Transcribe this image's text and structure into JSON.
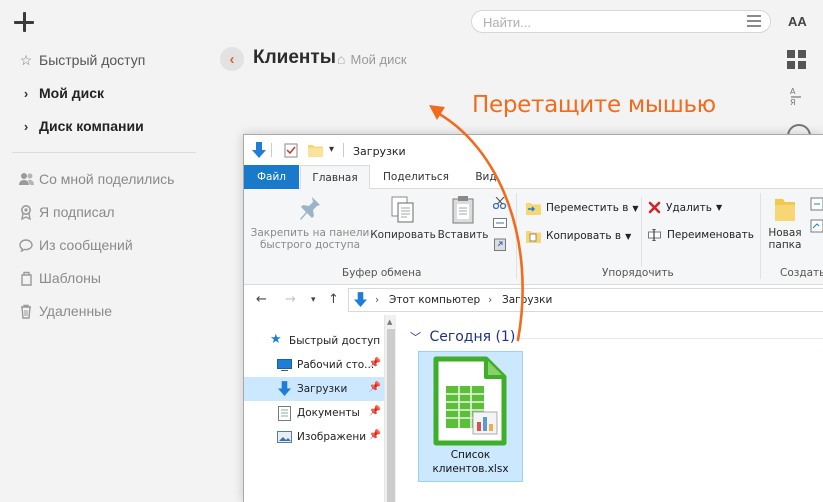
{
  "app": {
    "search_placeholder": "Найти...",
    "font_toggle_label": "AA",
    "sidebar": {
      "items": [
        {
          "label": "Быстрый доступ",
          "icon": "star-icon"
        },
        {
          "label": "Мой диск",
          "icon": "chevron-right-icon"
        },
        {
          "label": "Диск компании",
          "icon": "chevron-right-icon"
        },
        {
          "label": "Со мной поделились",
          "icon": "people-icon"
        },
        {
          "label": "Я подписал",
          "icon": "award-icon"
        },
        {
          "label": "Из сообщений",
          "icon": "chat-bubble-icon"
        },
        {
          "label": "Шаблоны",
          "icon": "template-icon"
        },
        {
          "label": "Удаленные",
          "icon": "trash-icon"
        }
      ]
    },
    "header": {
      "title": "Клиенты",
      "breadcrumb": "Мой диск"
    },
    "annotation": "Перетащите мышью",
    "accent_color": "#f26b1d"
  },
  "explorer": {
    "window_title": "Загрузки",
    "tabs": [
      "Файл",
      "Главная",
      "Поделиться",
      "Вид"
    ],
    "ribbon": {
      "pin_label_line1": "Закрепить на панели",
      "pin_label_line2": "быстрого доступа",
      "copy_label": "Копировать",
      "paste_label": "Вставить",
      "clipboard_group": "Буфер обмена",
      "move_to": "Переместить в",
      "copy_to": "Копировать в",
      "delete": "Удалить",
      "rename": "Переименовать",
      "organize_group": "Упорядочить",
      "new_folder_line1": "Новая",
      "new_folder_line2": "папка",
      "create_group": "Создать"
    },
    "address": {
      "parts": [
        "Этот компьютер",
        "Загрузки"
      ]
    },
    "nav": [
      {
        "label": "Быстрый доступ",
        "icon": "star-icon",
        "pinned": false,
        "selected": false
      },
      {
        "label": "Рабочий сто...",
        "icon": "desktop-icon",
        "pinned": true,
        "selected": false
      },
      {
        "label": "Загрузки",
        "icon": "download-arrow-icon",
        "pinned": true,
        "selected": true
      },
      {
        "label": "Документы",
        "icon": "documents-icon",
        "pinned": true,
        "selected": false
      },
      {
        "label": "Изображени",
        "icon": "pictures-icon",
        "pinned": true,
        "selected": false
      }
    ],
    "content": {
      "group_header": "Сегодня (1)",
      "file": {
        "name_line1": "Список",
        "name_line2": "клиентов.xlsx",
        "icon": "spreadsheet-icon"
      }
    },
    "ribbon_accent": "#1979ca",
    "selection_color": "#cce8ff"
  }
}
